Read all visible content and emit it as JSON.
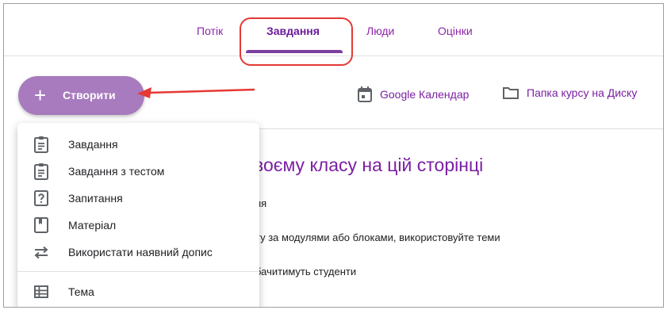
{
  "tabs": [
    {
      "label": "Потік"
    },
    {
      "label": "Завдання"
    },
    {
      "label": "Люди"
    },
    {
      "label": "Оцінки"
    }
  ],
  "create_button": {
    "plus": "+",
    "label": "Створити"
  },
  "links": {
    "calendar": "Google Календар",
    "folder": "Папка курсу на Диску"
  },
  "card": {
    "heading": "воєму класу на цій сторінці",
    "lines": [
      "ня",
      "ту за модулями або блоками, використовуйте теми",
      "бачитимуть студенти"
    ]
  },
  "menu": {
    "items": [
      {
        "label": "Завдання",
        "icon": "assignment-icon"
      },
      {
        "label": "Завдання з тестом",
        "icon": "quiz-assignment-icon"
      },
      {
        "label": "Запитання",
        "icon": "question-icon"
      },
      {
        "label": "Матеріал",
        "icon": "material-icon"
      },
      {
        "label": "Використати наявний допис",
        "icon": "reuse-post-icon"
      },
      {
        "label": "Тема",
        "icon": "topic-icon"
      }
    ]
  },
  "colors": {
    "accent": "#7b1fa2",
    "button": "#a77bbd",
    "highlight": "#e53935"
  }
}
